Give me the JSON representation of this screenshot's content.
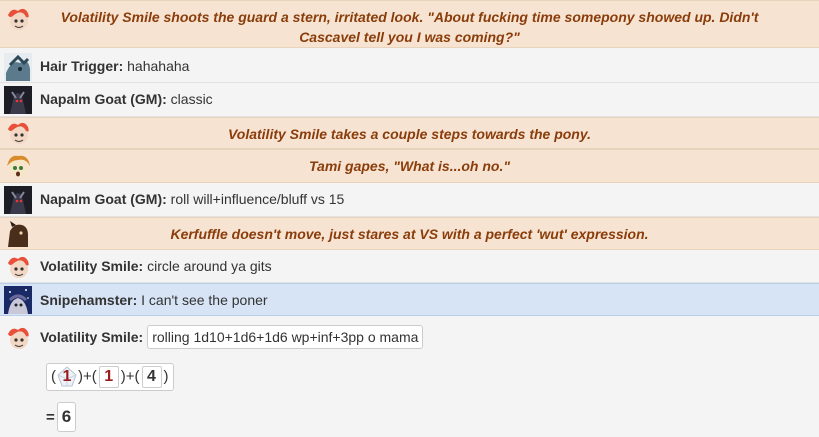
{
  "messages": [
    {
      "type": "emote",
      "avatar": "volatility-smile-avatar",
      "text": "Volatility Smile shoots the guard a stern, irritated look. \"About fucking time somepony showed up. Didn't Cascavel tell you I was coming?\""
    },
    {
      "type": "general",
      "avatar": "hair-trigger-avatar",
      "by": "Hair Trigger:",
      "text": "hahahaha"
    },
    {
      "type": "general",
      "avatar": "napalm-goat-avatar",
      "by": "Napalm Goat (GM):",
      "text": "classic"
    },
    {
      "type": "emote",
      "avatar": "volatility-smile-avatar",
      "text": "Volatility Smile takes a couple steps towards the pony."
    },
    {
      "type": "emote",
      "avatar": "tami-avatar",
      "text": "Tami gapes, \"What is...oh no.\""
    },
    {
      "type": "general",
      "avatar": "napalm-goat-avatar",
      "by": "Napalm Goat (GM):",
      "text": "roll will+influence/bluff vs 15"
    },
    {
      "type": "emote",
      "avatar": "kerfuffle-avatar",
      "text": "Kerfuffle doesn't move, just stares at VS with a perfect 'wut' expression."
    },
    {
      "type": "general",
      "avatar": "volatility-smile-avatar",
      "by": "Volatility Smile:",
      "text": "circle around ya gits"
    },
    {
      "type": "general",
      "avatar": "snipehamster-avatar",
      "by": "Snipehamster:",
      "text": "I can't see the poner",
      "highlight": true
    }
  ],
  "roll": {
    "avatar": "volatility-smile-avatar",
    "by": "Volatility Smile:",
    "command": "rolling 1d10+1d6+1d6 wp+inf+3pp o mama",
    "open": "(",
    "sep1": ")+(",
    "sep2": ")+(",
    "close": ")",
    "dice": [
      "1",
      "1",
      "4"
    ],
    "equals": "=",
    "total": "6"
  },
  "colors": {
    "emote_bg": "#f6e3d2",
    "emote_text": "#8a3d0a",
    "highlight_bg": "#d6e4f5",
    "crit_fail": "#9b1a1a"
  }
}
